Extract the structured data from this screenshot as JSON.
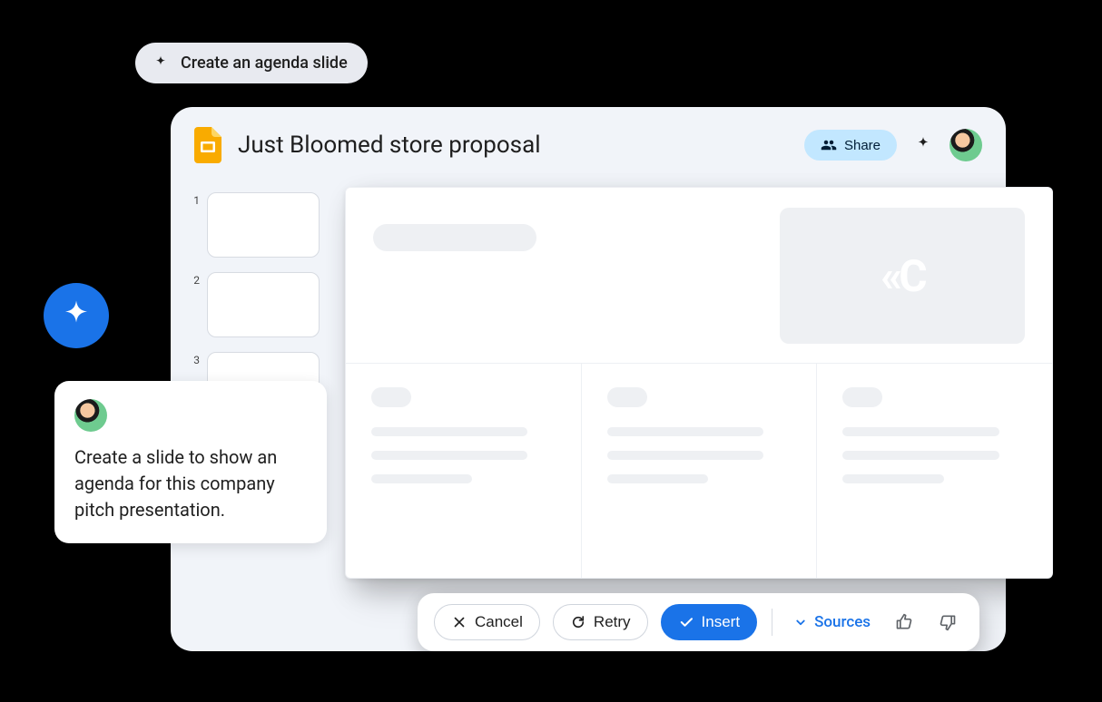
{
  "suggestion": {
    "label": "Create an agenda slide"
  },
  "doc": {
    "title": "Just Bloomed store proposal"
  },
  "header": {
    "share_label": "Share"
  },
  "thumbnails": {
    "numbers": [
      "1",
      "2",
      "3"
    ]
  },
  "canvas": {
    "logo_text": "«C"
  },
  "prompt": {
    "text": "Create a slide to show an agenda for this company pitch presentation."
  },
  "actions": {
    "cancel": "Cancel",
    "retry": "Retry",
    "insert": "Insert",
    "sources": "Sources"
  }
}
